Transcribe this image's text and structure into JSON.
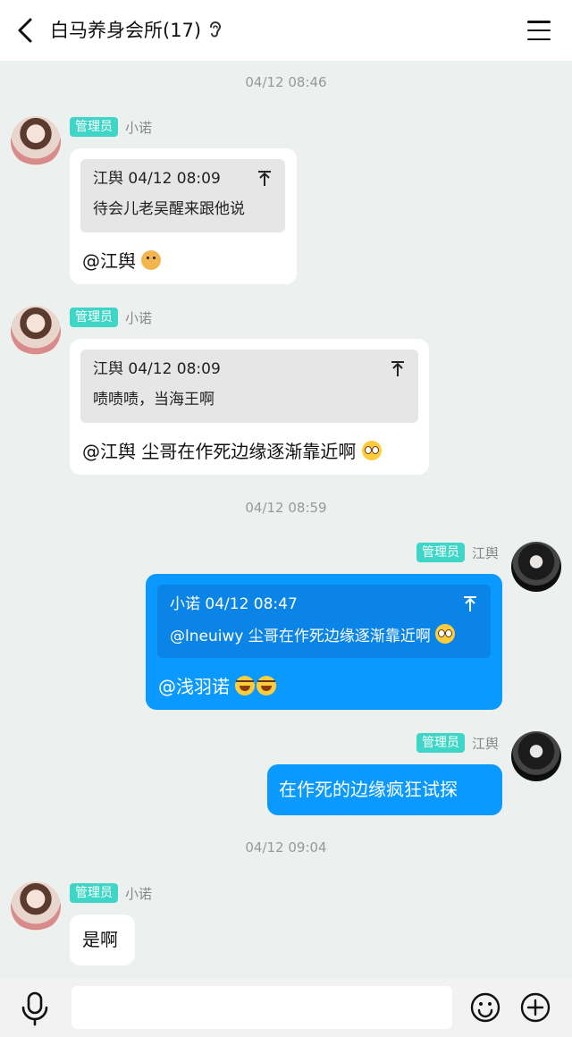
{
  "header": {
    "title": "白马养身会所(17)",
    "back_icon": "chevron-left-icon",
    "ear_icon": "ear-icon",
    "menu_icon": "hamburger-menu-icon"
  },
  "timestamps": [
    "04/12 08:46",
    "04/12 08:59",
    "04/12 09:04"
  ],
  "messages": [
    {
      "side": "left",
      "badge": "管理员",
      "nick": "小诺",
      "quote": {
        "author_time": "江舆 04/12 08:09",
        "text": "待会儿老吴醒来跟他说"
      },
      "text": "@江舆",
      "emoji": "dog-face-emoji"
    },
    {
      "side": "left",
      "badge": "管理员",
      "nick": "小诺",
      "quote": {
        "author_time": "江舆 04/12 08:09",
        "text": "啧啧啧，当海王啊"
      },
      "text": "@江舆 尘哥在作死边缘逐渐靠近啊",
      "emoji": "pleading-face-emoji"
    },
    {
      "side": "right",
      "badge": "管理员",
      "nick": "江舆",
      "quote": {
        "author_time": "小诺 04/12 08:47",
        "text": "@lneuiwy 尘哥在作死边缘逐渐靠近啊"
      },
      "text": "@浅羽诺",
      "emoji": "tears-of-joy-emoji"
    },
    {
      "side": "right",
      "badge": "管理员",
      "nick": "江舆",
      "text": "在作死的边缘疯狂试探"
    },
    {
      "side": "left",
      "badge": "管理员",
      "nick": "小诺",
      "text": "是啊"
    }
  ],
  "input_bar": {
    "placeholder": "",
    "mic_icon": "microphone-icon",
    "emoji_icon": "smiley-icon",
    "plus_icon": "plus-circle-icon"
  },
  "colors": {
    "background": "#ecf0ee",
    "badge": "#3ed6c7",
    "my_bubble": "#0a99ff",
    "my_quote": "#0a84e6",
    "other_bubble": "#ffffff",
    "other_quote": "#e6e6e6"
  }
}
